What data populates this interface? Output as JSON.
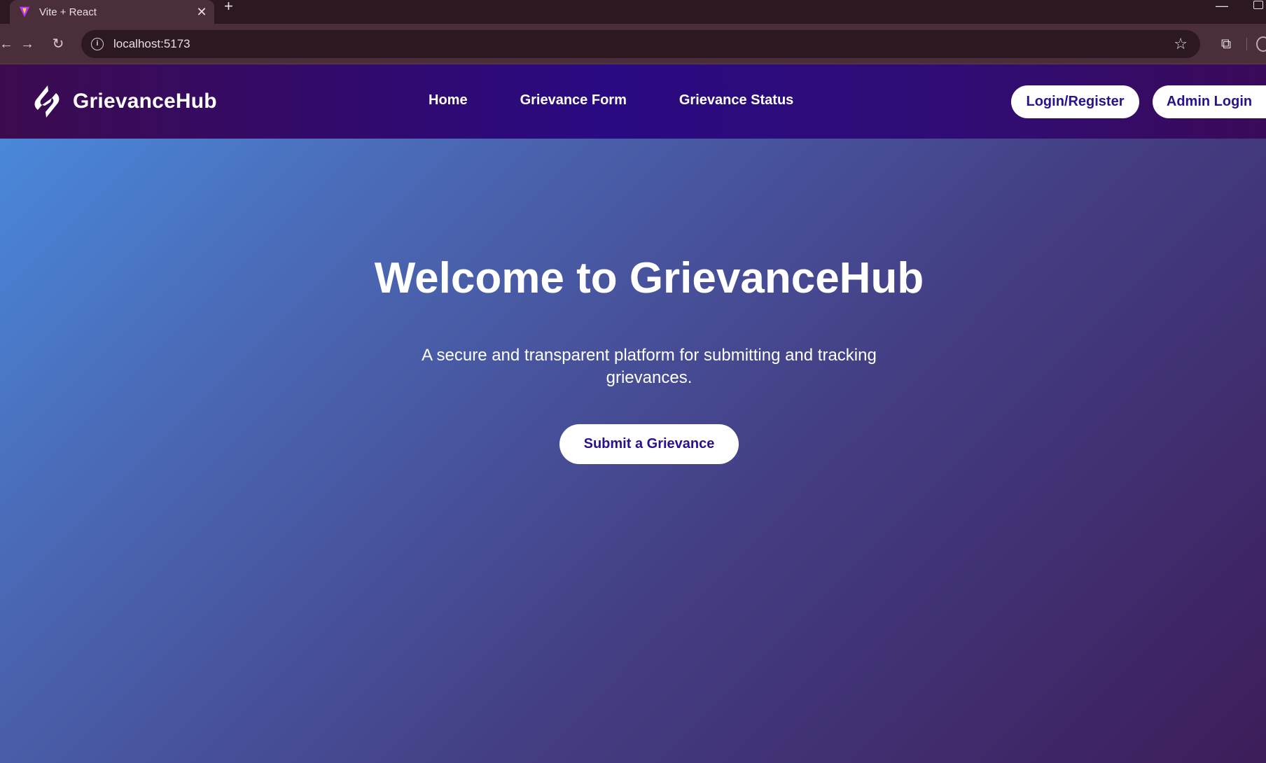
{
  "browser": {
    "tab_title": "Vite + React",
    "tab_close": "✕",
    "new_tab": "+",
    "url": "localhost:5173",
    "icons": {
      "favicon": "vite-favicon-icon",
      "back": "back-arrow-icon",
      "forward": "forward-arrow-icon",
      "reload": "reload-icon",
      "info": "site-info-icon",
      "star": "bookmark-star-icon",
      "extensions": "extensions-puzzle-icon"
    }
  },
  "navbar": {
    "brand": "GrievanceHub",
    "links": [
      "Home",
      "Grievance Form",
      "Grievance Status"
    ],
    "login_label": "Login/Register",
    "admin_label": "Admin Login"
  },
  "hero": {
    "title": "Welcome to GrievanceHub",
    "subtitle": "A secure and transparent platform for submitting and tracking grievances.",
    "cta_label": "Submit a Grievance"
  },
  "colors": {
    "navbar_start": "#3c0b4f",
    "navbar_mid": "#2a0a82",
    "hero_start": "#4a8de0",
    "hero_end": "#3d1d5a",
    "button_text": "#2b1090"
  }
}
